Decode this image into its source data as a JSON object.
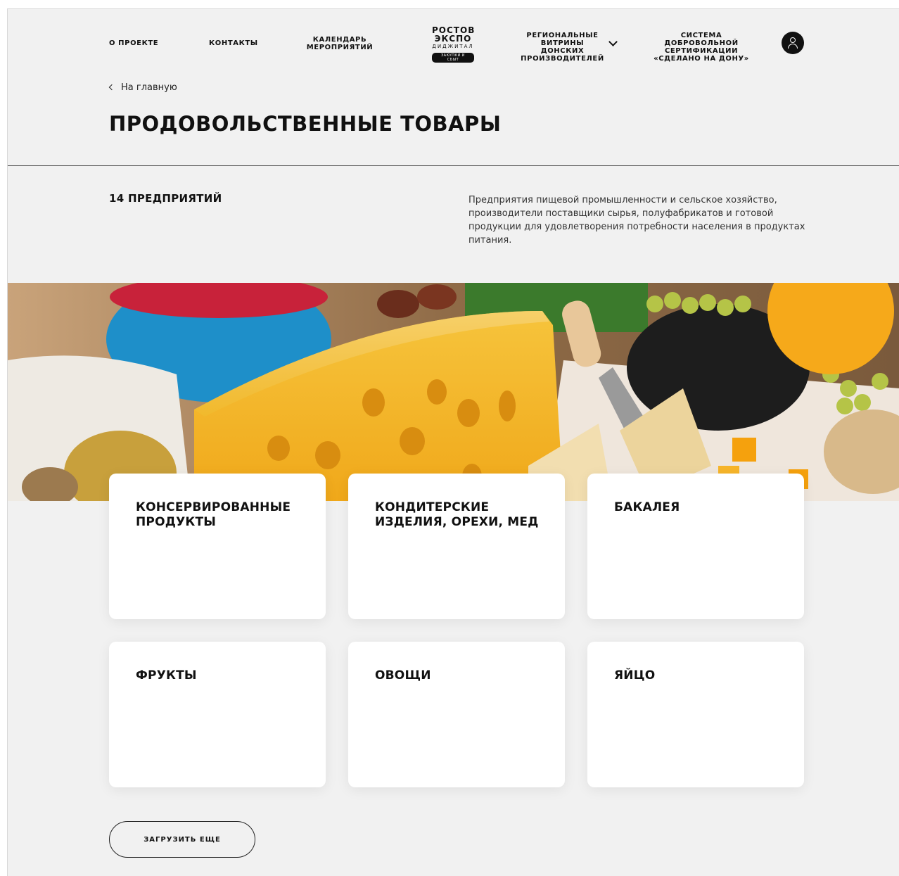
{
  "nav": {
    "about": "О ПРОЕКТЕ",
    "contacts": "КОНТАКТЫ",
    "calendar_line1": "КАЛЕНДАРЬ",
    "calendar_line2": "МЕРОПРИЯТИЙ",
    "regional_line1": "РЕГИОНАЛЬНЫЕ",
    "regional_line2": "ВИТРИНЫ ДОНСКИХ",
    "regional_line3": "ПРОИЗВОДИТЕЛЕЙ",
    "cert_line1": "СИСТЕМА ДОБРОВОЛЬНОЙ",
    "cert_line2": "СЕРТИФИКАЦИИ",
    "cert_line3": "«СДЕЛАНО НА ДОНУ»"
  },
  "logo": {
    "line1": "РОСТОВ",
    "line2": "ЭКСПО",
    "line3": "ДИДЖИТАЛ",
    "badge": "ЗАКУПКИ И СБЫТ"
  },
  "breadcrumb": {
    "back_label": "На главную"
  },
  "page": {
    "title": "ПРОДОВОЛЬСТВЕННЫЕ ТОВАРЫ",
    "count": "14 ПРЕДПРИЯТИЙ",
    "description": "Предприятия пищевой промышленности и сельское хозяйство, производители поставщики сырья, полуфабрикатов и готовой продукции для удовлетворения потребности населения в продуктах питания."
  },
  "categories": [
    {
      "label_line1": "КОНСЕРВИРОВАННЫЕ",
      "label_line2": "ПРОДУКТЫ"
    },
    {
      "label_line1": "КОНДИТЕРСКИЕ",
      "label_line2": "ИЗДЕЛИЯ, ОРЕХИ, МЕД"
    },
    {
      "label_line1": "БАКАЛЕЯ",
      "label_line2": ""
    },
    {
      "label_line1": "ФРУКТЫ",
      "label_line2": ""
    },
    {
      "label_line1": "ОВОЩИ",
      "label_line2": ""
    },
    {
      "label_line1": "ЯЙЦО",
      "label_line2": ""
    }
  ],
  "load_more": "ЗАГРУЗИТЬ ЕЩЕ",
  "colors": {
    "background": "#f1f1f1",
    "text": "#111111",
    "card": "#ffffff",
    "cheese": "#f2b41e"
  }
}
